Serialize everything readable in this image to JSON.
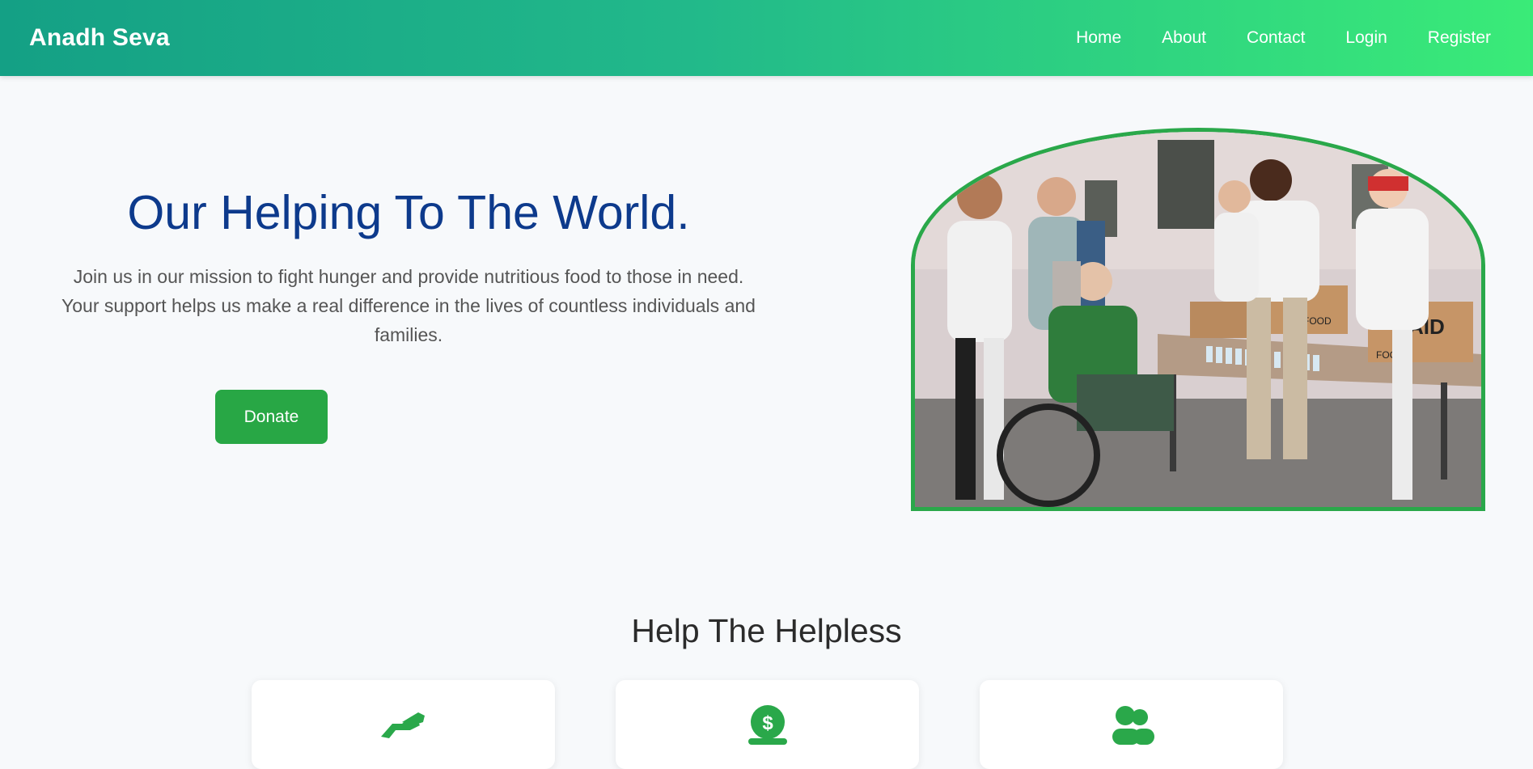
{
  "header": {
    "brand": "Anadh Seva",
    "nav": [
      "Home",
      "About",
      "Contact",
      "Login",
      "Register"
    ]
  },
  "hero": {
    "title": "Our Helping To The World.",
    "text": "Join us in our mission to fight hunger and provide nutritious food to those in need. Your support helps us make a real difference in the lives of countless individuals and families.",
    "button": "Donate",
    "image_box_labels": [
      "FOOD",
      "FOOD",
      "AID"
    ]
  },
  "section": {
    "title": "Help The Helpless",
    "cards": [
      {
        "icon": "hand-holding-heart-icon"
      },
      {
        "icon": "donate-coin-icon"
      },
      {
        "icon": "users-icon"
      }
    ]
  },
  "colors": {
    "header_start": "#14a085",
    "header_end": "#3aeb78",
    "title_blue": "#0d3a8c",
    "accent_green": "#28a745"
  }
}
